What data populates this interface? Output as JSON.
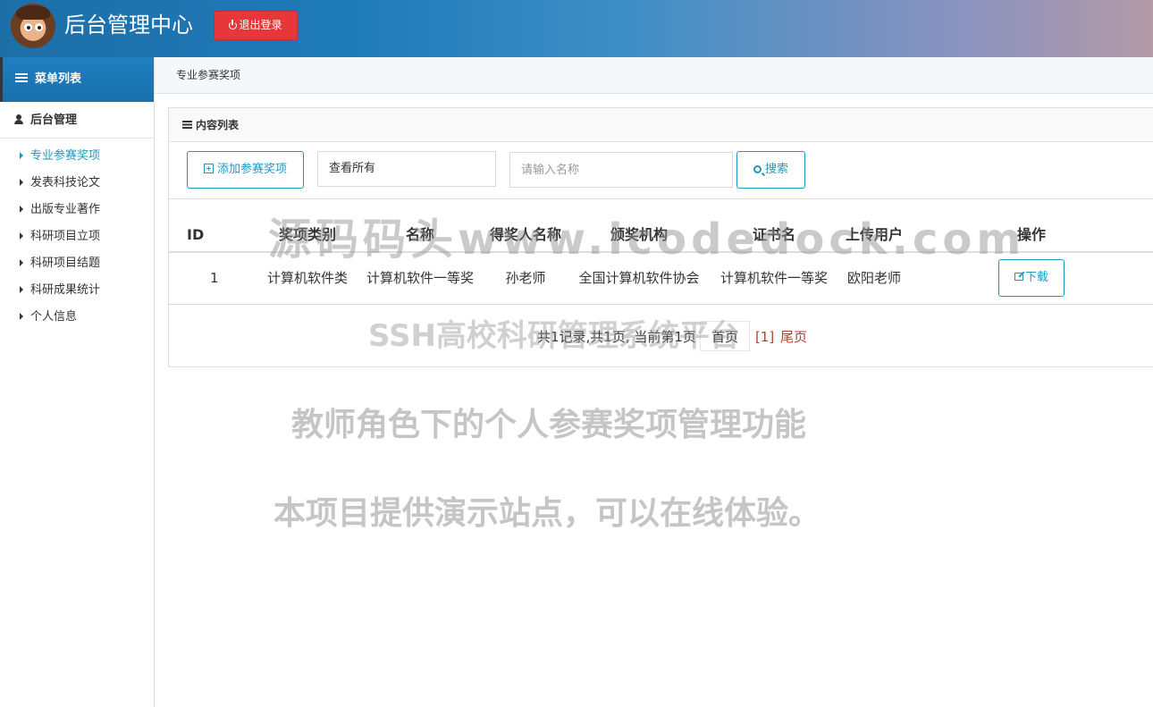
{
  "header": {
    "title": "后台管理中心",
    "logout_label": "退出登录"
  },
  "sidebar": {
    "menu_title": "菜单列表",
    "group_title": "后台管理",
    "items": [
      {
        "label": "专业参赛奖项",
        "active": true
      },
      {
        "label": "发表科技论文"
      },
      {
        "label": "出版专业著作"
      },
      {
        "label": "科研项目立项"
      },
      {
        "label": "科研项目结题"
      },
      {
        "label": "科研成果统计"
      },
      {
        "label": "个人信息"
      }
    ]
  },
  "breadcrumb": "专业参赛奖项",
  "panel": {
    "title": "内容列表",
    "add_button": "添加参赛奖项",
    "filter_value": "查看所有",
    "search_placeholder": "请输入名称",
    "search_button": "搜索"
  },
  "table": {
    "headers": [
      "ID",
      "奖项类别",
      "名称",
      "得奖人名称",
      "颁奖机构",
      "证书名",
      "上传用户",
      "操作"
    ],
    "rows": [
      {
        "id": "1",
        "category": "计算机软件类",
        "name": "计算机软件一等奖",
        "winner": "孙老师",
        "org": "全国计算机软件协会",
        "cert": "计算机软件一等奖",
        "uploader": "欧阳老师",
        "action": "下载"
      }
    ]
  },
  "pager": {
    "summary": "共1记录,共1页, 当前第1页",
    "first": "首页",
    "current": "[1]",
    "last": "尾页"
  },
  "watermarks": [
    "源码码头www.icodedock.com",
    "SSH高校科研管理系统平台",
    "教师角色下的个人参赛奖项管理功能",
    "本项目提供演示站点，可以在线体验。"
  ],
  "colors": {
    "accent": "#1a9bc2",
    "logout": "#e8373a",
    "header_start": "#1d6fa8",
    "pager_link": "#c0392b"
  }
}
